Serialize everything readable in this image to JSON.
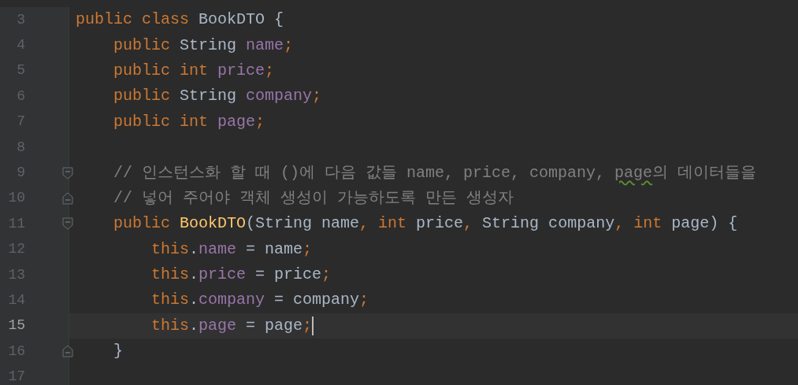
{
  "editor": {
    "lines": [
      {
        "number": "3",
        "current": false,
        "fold_start": false,
        "fold_end": false,
        "kind": "top",
        "tokens": [
          {
            "kind": "keyword",
            "text": "public class "
          },
          {
            "kind": "plain",
            "text": "BookDTO {"
          }
        ]
      },
      {
        "number": "4",
        "current": false,
        "fold_start": false,
        "fold_end": false,
        "kind": "member",
        "tokens": [
          {
            "kind": "keyword",
            "text": "public "
          },
          {
            "kind": "plain",
            "text": "String "
          },
          {
            "kind": "field",
            "text": "name"
          },
          {
            "kind": "keyword",
            "text": ";"
          }
        ]
      },
      {
        "number": "5",
        "current": false,
        "fold_start": false,
        "fold_end": false,
        "kind": "member",
        "tokens": [
          {
            "kind": "keyword",
            "text": "public int "
          },
          {
            "kind": "field",
            "text": "price"
          },
          {
            "kind": "keyword",
            "text": ";"
          }
        ]
      },
      {
        "number": "6",
        "current": false,
        "fold_start": false,
        "fold_end": false,
        "kind": "member",
        "tokens": [
          {
            "kind": "keyword",
            "text": "public "
          },
          {
            "kind": "plain",
            "text": "String "
          },
          {
            "kind": "field",
            "text": "company"
          },
          {
            "kind": "keyword",
            "text": ";"
          }
        ]
      },
      {
        "number": "7",
        "current": false,
        "fold_start": false,
        "fold_end": false,
        "kind": "member",
        "tokens": [
          {
            "kind": "keyword",
            "text": "public int "
          },
          {
            "kind": "field",
            "text": "page"
          },
          {
            "kind": "keyword",
            "text": ";"
          }
        ]
      },
      {
        "number": "8",
        "current": false,
        "fold_start": false,
        "fold_end": false,
        "kind": "top"
      },
      {
        "number": "9",
        "current": false,
        "fold_start": true,
        "fold_end": false,
        "kind": "member",
        "tokens": [
          {
            "kind": "comment",
            "text": "// 인스턴스화 할 때 ()에 다음 값들 name, price, company, "
          },
          {
            "kind": "typo",
            "text": "page"
          },
          {
            "kind": "comment",
            "text": "의 데이터들을"
          }
        ]
      },
      {
        "number": "10",
        "current": false,
        "fold_start": false,
        "fold_end": true,
        "kind": "member",
        "tokens": [
          {
            "kind": "comment",
            "text": "// 넣어 주어야 객체 생성이 가능하도록 만든 생성자"
          }
        ]
      },
      {
        "number": "11",
        "current": false,
        "fold_start": true,
        "fold_end": false,
        "kind": "member",
        "tokens": [
          {
            "kind": "keyword",
            "text": "public "
          },
          {
            "kind": "method",
            "text": "BookDTO"
          },
          {
            "kind": "plain",
            "text": "(String name"
          },
          {
            "kind": "keyword",
            "text": ", int "
          },
          {
            "kind": "plain",
            "text": "price"
          },
          {
            "kind": "keyword",
            "text": ", "
          },
          {
            "kind": "plain",
            "text": "String company"
          },
          {
            "kind": "keyword",
            "text": ", int "
          },
          {
            "kind": "plain",
            "text": "page) {"
          }
        ]
      },
      {
        "number": "12",
        "current": false,
        "fold_start": false,
        "fold_end": false,
        "kind": "statement",
        "tokens": [
          {
            "kind": "keyword",
            "text": "this"
          },
          {
            "kind": "plain",
            "text": "."
          },
          {
            "kind": "field",
            "text": "name"
          },
          {
            "kind": "plain",
            "text": " = name"
          },
          {
            "kind": "keyword",
            "text": ";"
          }
        ]
      },
      {
        "number": "13",
        "current": false,
        "fold_start": false,
        "fold_end": false,
        "kind": "statement",
        "tokens": [
          {
            "kind": "keyword",
            "text": "this"
          },
          {
            "kind": "plain",
            "text": "."
          },
          {
            "kind": "field",
            "text": "price"
          },
          {
            "kind": "plain",
            "text": " = price"
          },
          {
            "kind": "keyword",
            "text": ";"
          }
        ]
      },
      {
        "number": "14",
        "current": false,
        "fold_start": false,
        "fold_end": false,
        "kind": "statement",
        "tokens": [
          {
            "kind": "keyword",
            "text": "this"
          },
          {
            "kind": "plain",
            "text": "."
          },
          {
            "kind": "field",
            "text": "company"
          },
          {
            "kind": "plain",
            "text": " = company"
          },
          {
            "kind": "keyword",
            "text": ";"
          }
        ]
      },
      {
        "number": "15",
        "current": true,
        "fold_start": false,
        "fold_end": false,
        "kind": "statement",
        "tokens": [
          {
            "kind": "keyword",
            "text": "this"
          },
          {
            "kind": "plain",
            "text": "."
          },
          {
            "kind": "field",
            "text": "page"
          },
          {
            "kind": "plain",
            "text": " = page"
          },
          {
            "kind": "keyword",
            "text": ";"
          }
        ]
      },
      {
        "number": "16",
        "current": false,
        "fold_start": false,
        "fold_end": true,
        "kind": "member",
        "tokens": [
          {
            "kind": "plain",
            "text": "}"
          }
        ]
      },
      {
        "number": "17",
        "current": false,
        "fold_start": false,
        "fold_end": false,
        "kind": "top"
      }
    ]
  }
}
